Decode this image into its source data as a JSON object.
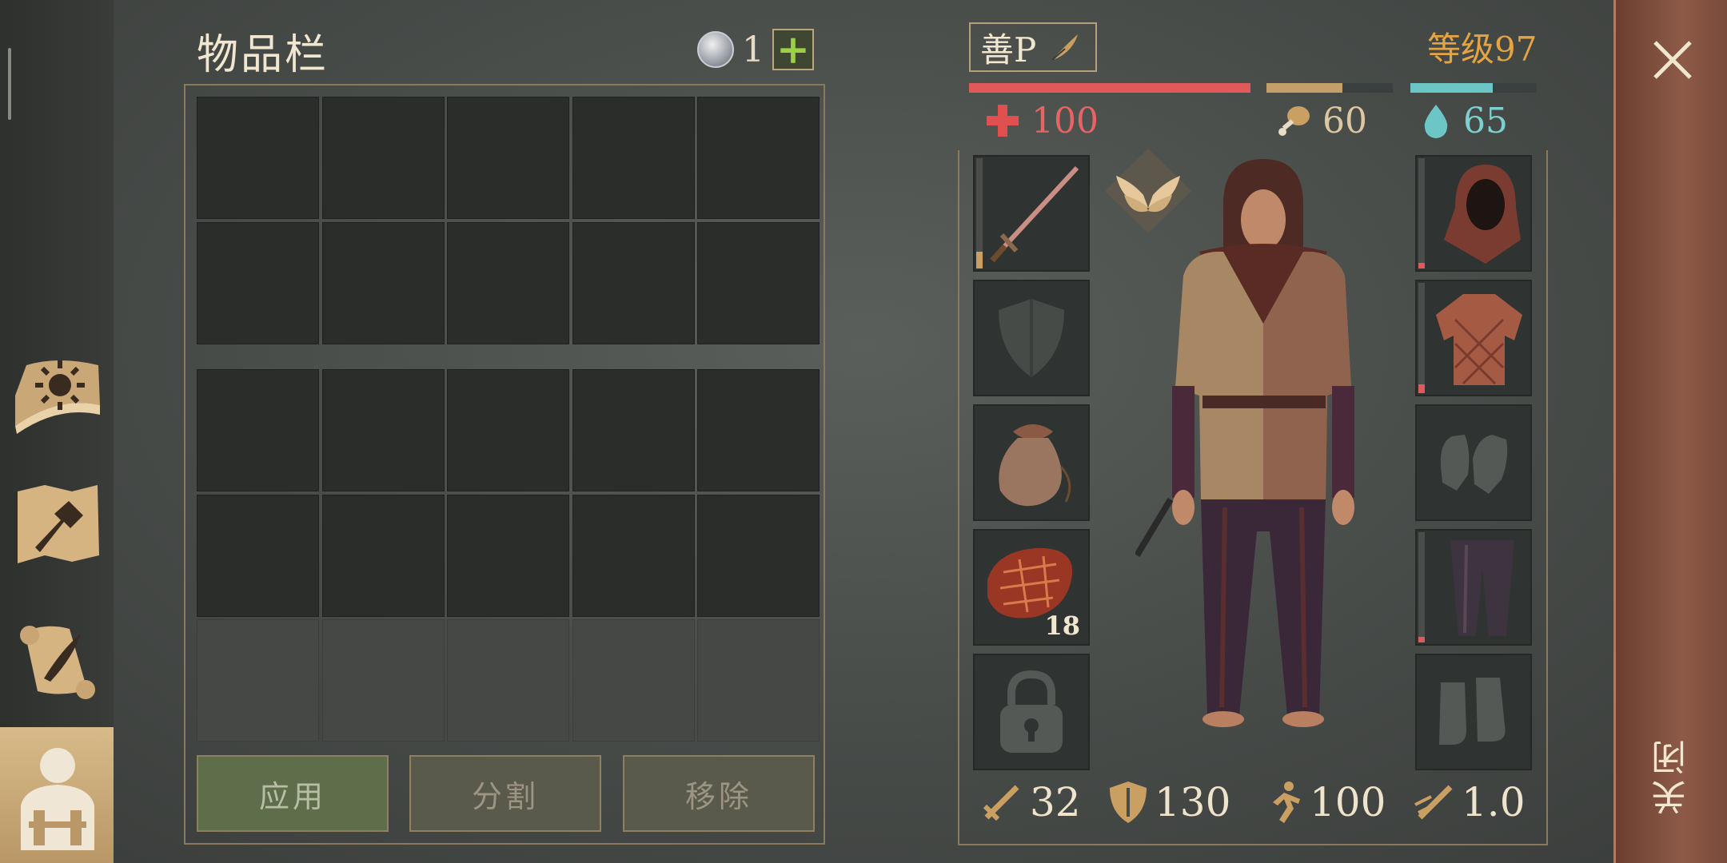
{
  "inventory": {
    "title": "物品栏",
    "currency_count": "1",
    "currency_icon": "silver-coin-icon",
    "add_icon": "plus-icon",
    "rows": 5,
    "columns": 5,
    "unlocked_rows": 4,
    "buttons": {
      "apply": "应用",
      "split": "分割",
      "remove": "移除"
    }
  },
  "character": {
    "name": "善P",
    "edit_icon": "quill-icon",
    "level": "等级97",
    "health": {
      "value": "100",
      "fill": 1.0,
      "color": "#e05a5a",
      "icon": "red-cross-icon"
    },
    "food": {
      "value": "60",
      "fill": 0.6,
      "color": "#c3a06a",
      "icon": "drumstick-icon"
    },
    "water": {
      "value": "65",
      "fill": 0.65,
      "color": "#6dc6c6",
      "icon": "water-drop-icon"
    },
    "rank_icon": "wings-emblem-icon",
    "left_slots": [
      {
        "name": "weapon",
        "icon": "sword-icon",
        "durability": 0.15,
        "count": ""
      },
      {
        "name": "shield",
        "icon": "shield-icon",
        "durability": 0,
        "count": ""
      },
      {
        "name": "bag",
        "icon": "pouch-icon",
        "durability": 0,
        "count": ""
      },
      {
        "name": "food",
        "icon": "cooked-meat-icon",
        "durability": 0,
        "count": "18"
      },
      {
        "name": "locked",
        "icon": "padlock-icon",
        "durability": 0,
        "count": ""
      }
    ],
    "right_slots": [
      {
        "name": "head",
        "icon": "hood-icon",
        "durability": 0.05
      },
      {
        "name": "chest",
        "icon": "quilted-jacket-icon",
        "durability": 0.08
      },
      {
        "name": "hands",
        "icon": "gloves-icon",
        "durability": 0
      },
      {
        "name": "legs",
        "icon": "pants-icon",
        "durability": 0.05
      },
      {
        "name": "feet",
        "icon": "boots-icon",
        "durability": 0
      }
    ],
    "stats": {
      "attack": {
        "value": "32",
        "icon": "sword-stat-icon"
      },
      "armor": {
        "value": "130",
        "icon": "shield-stat-icon"
      },
      "speed": {
        "value": "100",
        "icon": "running-man-icon"
      },
      "attack_speed": {
        "value": "1.0",
        "icon": "quick-sword-icon"
      }
    }
  },
  "sidebar": [
    {
      "name": "sidebar-journal",
      "icon": "sun-book-icon"
    },
    {
      "name": "sidebar-crafting",
      "icon": "hammer-map-icon"
    },
    {
      "name": "sidebar-quests",
      "icon": "scroll-quill-icon"
    },
    {
      "name": "sidebar-character",
      "icon": "backpack-character-icon"
    }
  ],
  "close": {
    "label": "关闭",
    "icon": "close-x-icon"
  }
}
